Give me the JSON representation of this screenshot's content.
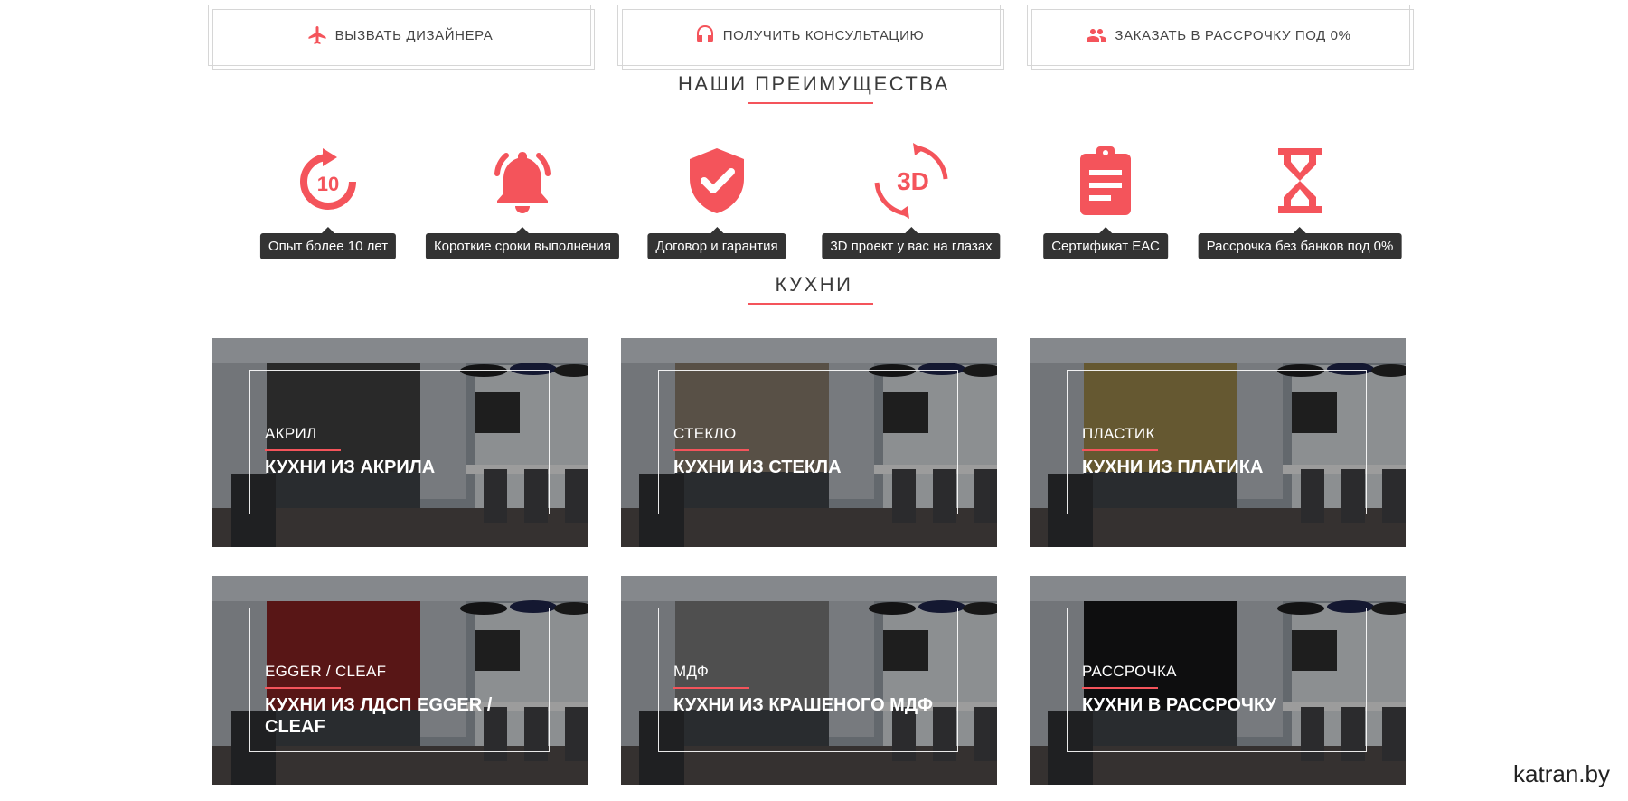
{
  "cta_buttons": [
    {
      "label": "Вызвать дизайнера",
      "icon": "airplane-icon"
    },
    {
      "label": "Получить консультацию",
      "icon": "headphones-icon"
    },
    {
      "label": "Заказать в рассрочку под 0%",
      "icon": "people-icon"
    }
  ],
  "advantages": {
    "title": "Наши преимущества",
    "items": [
      {
        "label": "Опыт более 10 лет",
        "icon": "replay-10-icon",
        "icon_text": "10"
      },
      {
        "label": "Короткие сроки выполнения",
        "icon": "bell-icon"
      },
      {
        "label": "Договор и гарантия",
        "icon": "shield-check-icon"
      },
      {
        "label": "3D проект у вас на глазах",
        "icon": "rotate-3d-icon",
        "icon_text": "3D"
      },
      {
        "label": "Сертификат ЕАС",
        "icon": "clipboard-icon"
      },
      {
        "label": "Рассрочка без банков под 0%",
        "icon": "hourglass-icon"
      }
    ]
  },
  "kitchens": {
    "title": "Кухни",
    "cards": [
      {
        "category": "Акрил",
        "name": "Кухни из акрила",
        "cabinet_color": "#3a3a3a"
      },
      {
        "category": "Стекло",
        "name": "Кухни из стекла",
        "cabinet_color": "#7a7062"
      },
      {
        "category": "Пластик",
        "name": "Кухни из платика",
        "cabinet_color": "#8c7a45"
      },
      {
        "category": "Egger / Cleaf",
        "name": "Кухни из ЛДСП Egger / Cleaf",
        "cabinet_color": "#7a1f1f"
      },
      {
        "category": "МДФ",
        "name": "Кухни из крашеного МДФ",
        "cabinet_color": "#6e6e6e"
      },
      {
        "category": "Рассрочка",
        "name": "Кухни в рассрочку",
        "cabinet_color": "#141416"
      }
    ]
  },
  "watermark": "katran.by",
  "colors": {
    "accent": "#f4545b",
    "tooltip_bg": "#333333"
  }
}
